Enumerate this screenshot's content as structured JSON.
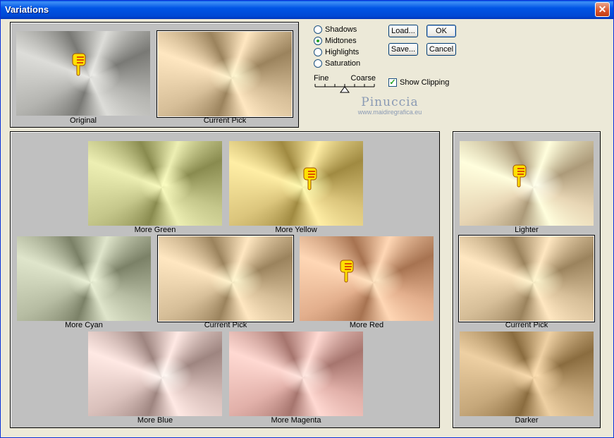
{
  "window": {
    "title": "Variations",
    "close": "✕"
  },
  "top": {
    "original": "Original",
    "current_pick": "Current Pick"
  },
  "options": {
    "radios": [
      {
        "label": "Shadows",
        "checked": false
      },
      {
        "label": "Midtones",
        "checked": true
      },
      {
        "label": "Highlights",
        "checked": false
      },
      {
        "label": "Saturation",
        "checked": false
      }
    ],
    "fine": "Fine",
    "coarse": "Coarse",
    "show_clipping": "Show Clipping",
    "show_clipping_checked": true
  },
  "buttons": {
    "load": "Load...",
    "ok": "OK",
    "save": "Save...",
    "cancel": "Cancel"
  },
  "watermark": {
    "name": "Pinuccia",
    "url": "www.maidiregrafica.eu"
  },
  "hue": {
    "more_green": "More Green",
    "more_yellow": "More Yellow",
    "more_cyan": "More Cyan",
    "current_pick": "Current Pick",
    "more_red": "More Red",
    "more_blue": "More Blue",
    "more_magenta": "More Magenta"
  },
  "brightness": {
    "lighter": "Lighter",
    "current_pick": "Current Pick",
    "darker": "Darker"
  },
  "colors": {
    "original": "#a6a6a2",
    "current_pick": "#c8b08a",
    "more_green": "#b6b87c",
    "more_yellow": "#cdb76e",
    "more_cyan": "#a8ae94",
    "more_red": "#d4a07e",
    "more_blue": "#cbb2ad",
    "more_magenta": "#d3a29b",
    "lighter": "#d9c7a6",
    "darker": "#b7996c"
  }
}
